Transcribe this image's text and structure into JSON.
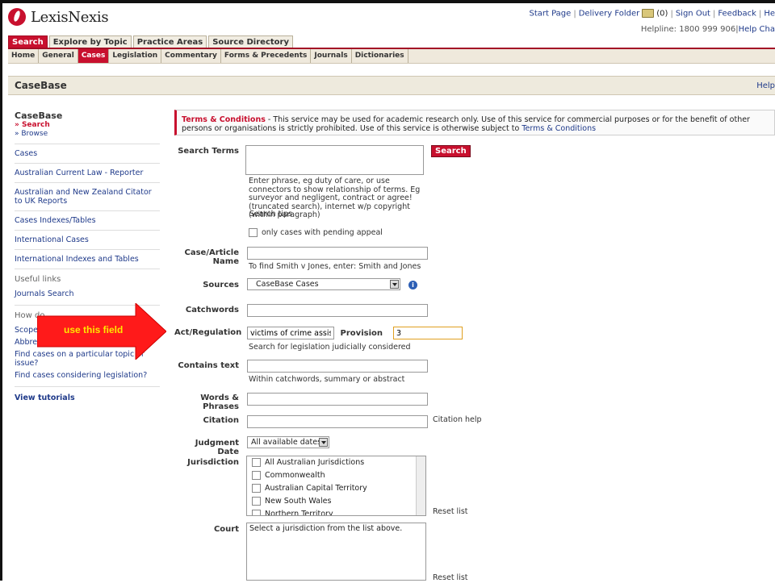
{
  "header": {
    "logo_text": "LexisNexis",
    "links": [
      "Start Page",
      "Delivery Folder",
      "(0)",
      "Sign Out",
      "Feedback",
      "He"
    ],
    "helpline": "Helpline: 1800 999 906",
    "help_chat": "Help Cha"
  },
  "main_tabs": [
    "Search",
    "Explore by Topic",
    "Practice Areas",
    "Source Directory"
  ],
  "sub_tabs": [
    "Home",
    "General",
    "Cases",
    "Legislation",
    "Commentary",
    "Forms & Precedents",
    "Journals",
    "Dictionaries"
  ],
  "page": {
    "title": "CaseBase",
    "help": "Help"
  },
  "sidebar": {
    "heading": "CaseBase",
    "search": "» Search",
    "browse": "» Browse",
    "items": [
      "Cases",
      "Australian Current Law - Reporter",
      "Australian and New Zealand Citator to UK Reports",
      "Cases Indexes/Tables",
      "International Cases",
      "International Indexes and Tables"
    ],
    "useful_links": "Useful links",
    "journals_search": "Journals Search",
    "how_do": "How do",
    "scope": "Scope/C",
    "abbrev": "Abbreviation/Subject list",
    "find_topic": "Find cases on a particular topic or issue?",
    "find_legislation": "Find cases considering legislation?",
    "view_tutorials": "View tutorials"
  },
  "terms": {
    "title": "Terms & Conditions",
    "text": " - This service may be used for academic research only. Use of this service for commercial purposes or for the benefit of other persons or organisations is strictly prohibited. Use of this service is otherwise subject to ",
    "link": "Terms & Conditions"
  },
  "form": {
    "search_terms_label": "Search Terms",
    "search_button": "Search",
    "hint_1": "Enter phrase, eg duty of care, or use connectors to show relationship of terms. Eg surveyor and negligent, contract or agree! (truncated search), internet w/p copyright (within paragraph)",
    "search_tips": "Search tips",
    "pending_appeal": "only cases with pending appeal",
    "case_article_label": "Case/Article Name",
    "case_hint": "To find Smith v Jones, enter: Smith and Jones",
    "sources_label": "Sources",
    "sources_value": "CaseBase Cases",
    "catchwords_label": "Catchwords",
    "act_label": "Act/Regulation",
    "act_value": "victims of crime assistar",
    "provision_label": "Provision",
    "provision_value": "3",
    "act_hint": "Search for legislation judicially considered",
    "contains_label": "Contains text",
    "contains_hint": "Within catchwords, summary or abstract",
    "words_label": "Words & Phrases",
    "citation_label": "Citation",
    "citation_help": "Citation help",
    "judgment_label": "Judgment Date",
    "judgment_value": "All available dates",
    "jurisdiction_label": "Jurisdiction",
    "jurisdictions": [
      "All Australian Jurisdictions",
      "Commonwealth",
      "Australian Capital Territory",
      "New South Wales",
      "Northern Territory"
    ],
    "reset_list": "Reset list",
    "court_label": "Court",
    "court_hint": "Select a jurisdiction from the list above.",
    "reset_list_2": "Reset list"
  },
  "annotation": {
    "text": "use this field",
    "color": "#ff1a1a"
  }
}
